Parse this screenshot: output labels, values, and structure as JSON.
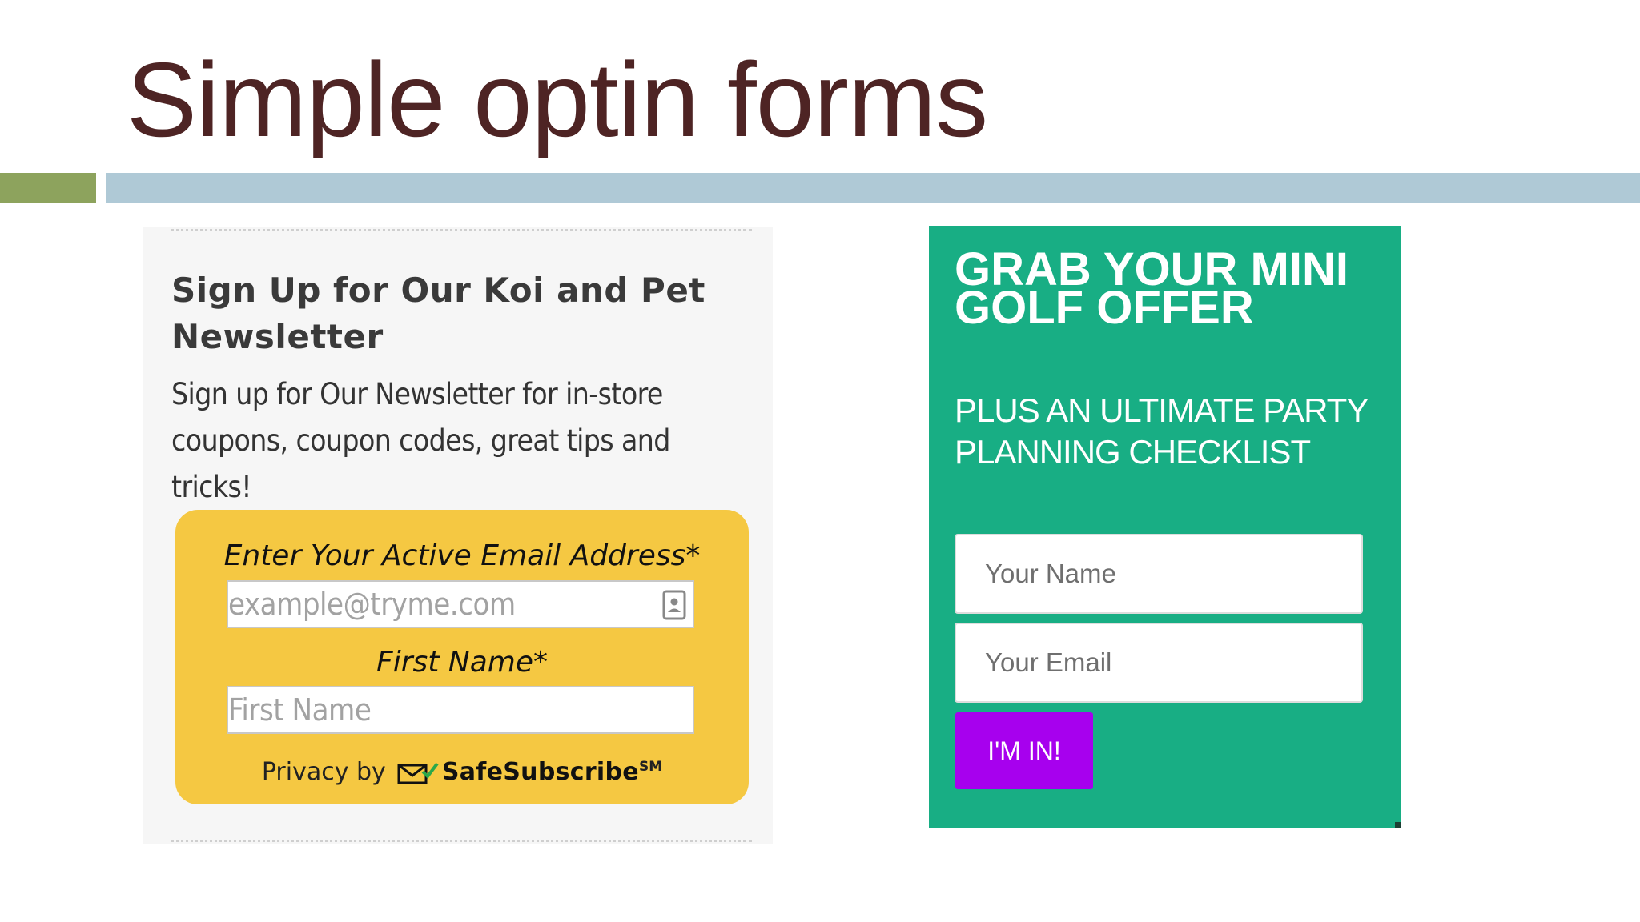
{
  "slide": {
    "title": "Simple optin forms"
  },
  "koi_form": {
    "heading": "Sign Up for Our Koi and Pet Newsletter",
    "description": "Sign up for Our Newsletter for in-store coupons, coupon codes, great tips and tricks!",
    "email_label": "Enter Your Active Email Address*",
    "email_placeholder": "example@tryme.com",
    "first_name_label": "First Name*",
    "first_name_placeholder": "First Name",
    "privacy_prefix": "Privacy by",
    "privacy_brand": "SafeSubscribe",
    "privacy_mark": "SM",
    "icons": [
      "contact-card-icon",
      "safesubscribe-mail-icon"
    ],
    "colors": {
      "panel": "#f6f6f6",
      "form": "#f5c842"
    }
  },
  "golf_form": {
    "heading": "GRAB YOUR MINI GOLF OFFER",
    "subheading": "PLUS AN ULTIMATE PARTY PLANNING CHECKLIST",
    "name_placeholder": "Your Name",
    "email_placeholder": "Your Email",
    "button_label": "I'M IN!",
    "colors": {
      "background": "#18ae84",
      "button": "#a700ee"
    }
  },
  "colors": {
    "title": "#4e2424",
    "accent_green": "#8da35d",
    "accent_blue": "#afc9d6"
  }
}
